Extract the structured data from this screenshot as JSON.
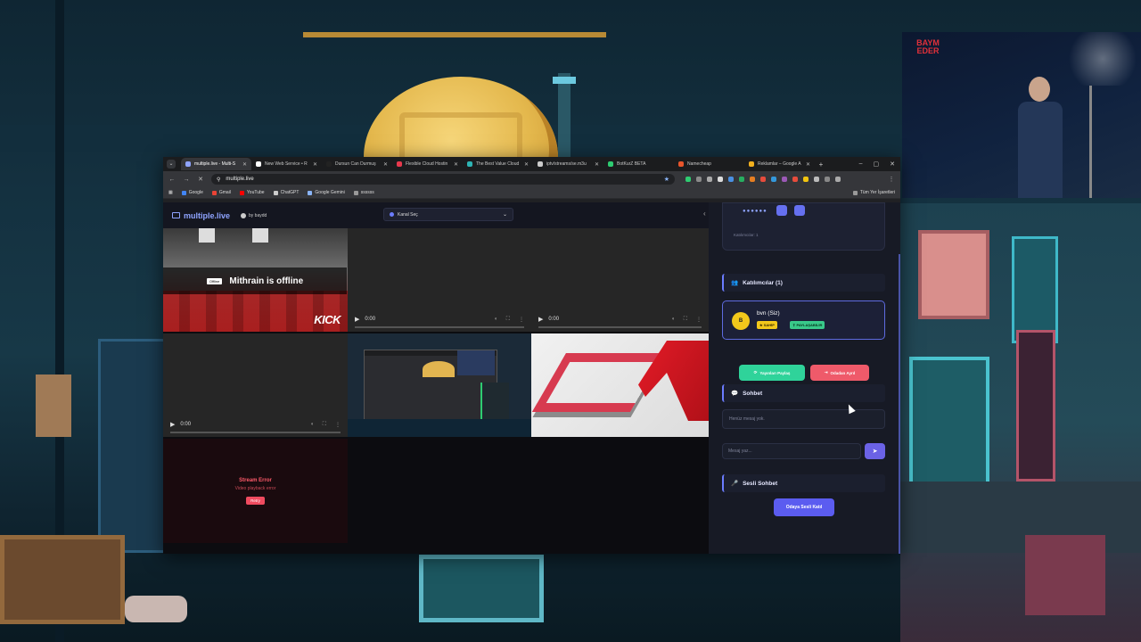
{
  "browser": {
    "tabs": [
      {
        "label": "multiple.live - Multi-S",
        "active": true,
        "color": "#8fa4ff"
      },
      {
        "label": "New Web Service • R",
        "active": false,
        "color": "#ffffff"
      },
      {
        "label": "Dursun Can Durmuş",
        "active": false,
        "color": "#222"
      },
      {
        "label": "Flexible Cloud Hostin",
        "active": false,
        "color": "#e8394d"
      },
      {
        "label": "The Best Value Cloud",
        "active": false,
        "color": "#2db4b4"
      },
      {
        "label": "iptv/streams/se.m3u",
        "active": false,
        "color": "#ccc"
      },
      {
        "label": "BotKurZ BETA",
        "active": false,
        "color": "#2ecc71"
      },
      {
        "label": "Namecheap",
        "active": false,
        "color": "#e8552b"
      },
      {
        "label": "Reklamlar – Google A",
        "active": false,
        "color": "#f2b01e"
      }
    ],
    "new_tab": "+",
    "url": "multiple.live",
    "bookmarks": [
      {
        "label": "Google",
        "color": "#4285f4"
      },
      {
        "label": "Gmail",
        "color": "#ea4335"
      },
      {
        "label": "YouTube",
        "color": "#ff0000"
      },
      {
        "label": "ChatGPT",
        "color": "#cccccc"
      },
      {
        "label": "Google Gemini",
        "color": "#8ab4f8"
      },
      {
        "label": "ssssss",
        "color": "#999999"
      }
    ],
    "all_bookmarks": "Tüm Yer İşaretleri"
  },
  "site": {
    "logo": "multiple.live",
    "by": "by baydd",
    "channel_select": "Kanal Seç",
    "collapse": "‹"
  },
  "streams": {
    "kick_badge": "Offline",
    "kick_offline": "Mithrain is offline",
    "kick_logo": "KICK",
    "time": "0:00",
    "error_title": "Stream Error",
    "error_msg": "Video playback error",
    "retry": "Retry"
  },
  "panel": {
    "top_dots": "●●●●●●",
    "top_participants": "Katılımcılar: 1",
    "participants_title": "Katılımcılar (1)",
    "user_initial": "B",
    "user_name": "bvn (Siz)",
    "owner_tag": "SAHİP",
    "sharing_tag": "PAYLAŞABİLİR",
    "share_btn": "Yayınları Paylaş",
    "leave_btn": "Odadan Ayrıl",
    "chat_title": "Sohbet",
    "no_messages": "Henüz mesaj yok.",
    "message_placeholder": "Mesaj yaz...",
    "voice_title": "Sesli Sohbet",
    "voice_join": "Odaya Sesli Katıl"
  },
  "webcam": {
    "logo_text": "BAYM EDER"
  },
  "colors": {
    "accent": "#6b7cff",
    "share_green": "#2fd39a",
    "leave_red": "#ef5a6a",
    "owner_yellow": "#f2c81b",
    "sharing_green": "#39c98a"
  }
}
